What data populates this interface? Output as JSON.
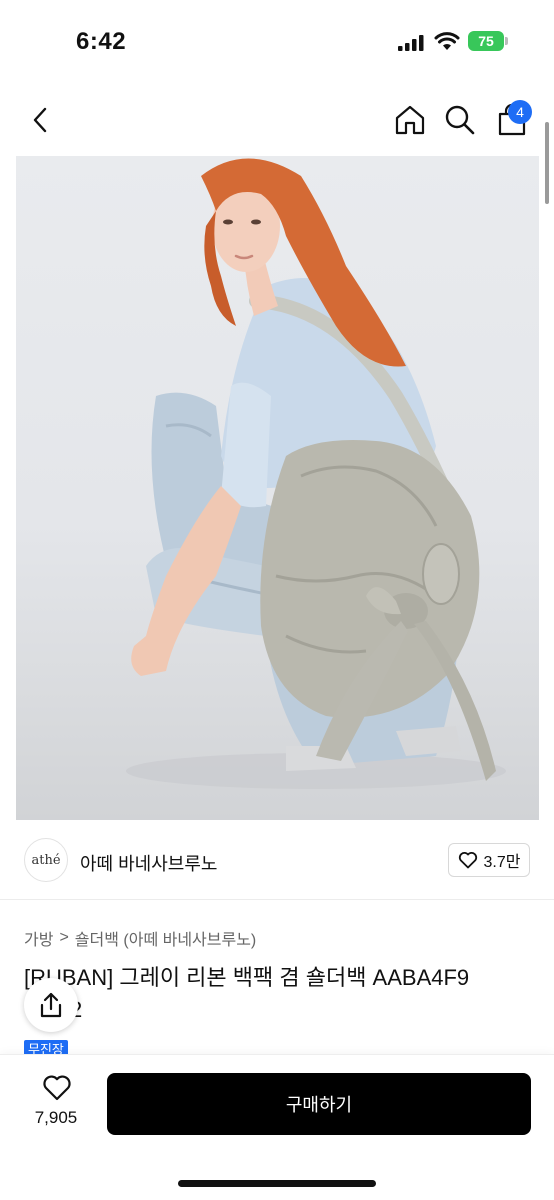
{
  "status_bar": {
    "time": "6:42",
    "battery": "75"
  },
  "nav": {
    "cart_count": "4"
  },
  "brand": {
    "logo_text": "athé",
    "name": "아떼 바네사브루노",
    "likes": "3.7만"
  },
  "breadcrumb": {
    "category": "가방",
    "separator": ">",
    "subcategory": "숄더백 (아떼 바네사브루노)"
  },
  "product": {
    "title_line1": "[RUBAN] 그레이 리본 백팩 겸 숄더백 AABA4F9",
    "title_line2": "2",
    "tag": "무진장"
  },
  "bottom_bar": {
    "wish_count": "7,905",
    "buy_label": "구매하기"
  },
  "colors": {
    "accent": "#1e6df5",
    "buy_button": "#000000",
    "battery": "#38c75a"
  },
  "icons": [
    "back-icon",
    "home-icon",
    "search-icon",
    "cart-icon",
    "heart-icon",
    "share-icon"
  ]
}
